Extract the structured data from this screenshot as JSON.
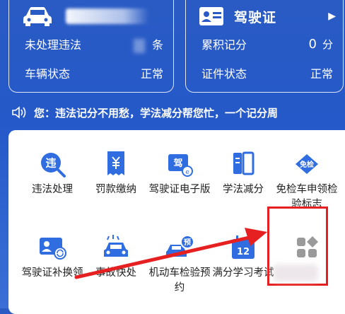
{
  "vehicle_card": {
    "pending_label": "未处理违法",
    "pending_unit": "条",
    "status_label": "车辆状态",
    "status_value": "正常"
  },
  "license_card": {
    "title": "驾驶证",
    "points_label": "累积记分",
    "points_value": "0",
    "points_unit": "分",
    "status_label": "证件状态",
    "status_value": "正常"
  },
  "notice": {
    "text": "您：违法记分不用愁，学法减分帮您忙，一个记分周"
  },
  "services": [
    {
      "label": "违法处理"
    },
    {
      "label": "罚款缴纳"
    },
    {
      "label": "驾驶证电子版"
    },
    {
      "label": "学法减分"
    },
    {
      "label": "免检车申领检验标志"
    },
    {
      "label": "驾驶证补换领"
    },
    {
      "label": "事故快处"
    },
    {
      "label": "机动车检验预约"
    },
    {
      "label": "满分学习考试"
    }
  ],
  "icon_text": {
    "mianjian": "免检",
    "yu": "预",
    "num12": "12",
    "jia": "驾"
  },
  "colors": {
    "header_blue": "#2559c9",
    "icon_blue": "#2f6de0",
    "highlight_red": "#e62020"
  }
}
